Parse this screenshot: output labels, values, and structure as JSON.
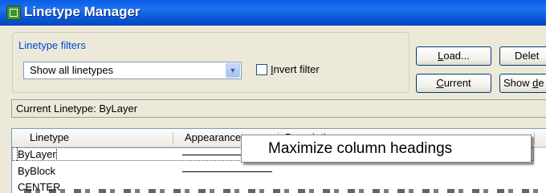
{
  "window": {
    "title": "Linetype Manager",
    "icon": "linetype-manager-icon"
  },
  "filters": {
    "group_label": "Linetype filters",
    "selected": "Show all linetypes",
    "invert_label_prefix": "",
    "invert_label_mnemonic": "I",
    "invert_label_rest": "nvert filter",
    "invert_checked": false
  },
  "buttons": {
    "load_mnemonic": "L",
    "load_rest": "oad...",
    "current_mnemonic": "C",
    "current_rest": "urrent",
    "delete": "Delet",
    "show_details_prefix": "Show ",
    "show_details_mnemonic": "d",
    "show_details_rest": "e"
  },
  "current_linetype": "Current Linetype:  ByLayer",
  "list": {
    "columns": [
      "Linetype",
      "Appearance",
      "Description"
    ],
    "rows": [
      {
        "name": "ByLayer",
        "selected": true
      },
      {
        "name": "ByBlock",
        "selected": false
      },
      {
        "name": "CENTER",
        "selected": false
      }
    ]
  },
  "tooltip": "Maximize column headings",
  "colors": {
    "titlebar": "#0a5ee6",
    "group_label": "#0046d5",
    "window_bg": "#ece9d8"
  }
}
